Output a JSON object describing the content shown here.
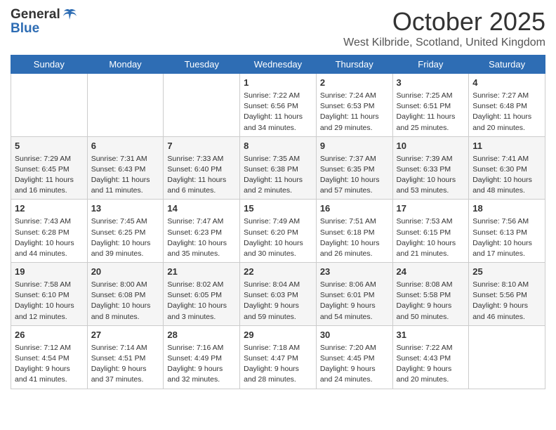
{
  "header": {
    "logo_line1": "General",
    "logo_line2": "Blue",
    "month": "October 2025",
    "location": "West Kilbride, Scotland, United Kingdom"
  },
  "days_of_week": [
    "Sunday",
    "Monday",
    "Tuesday",
    "Wednesday",
    "Thursday",
    "Friday",
    "Saturday"
  ],
  "weeks": [
    [
      {
        "day": "",
        "content": ""
      },
      {
        "day": "",
        "content": ""
      },
      {
        "day": "",
        "content": ""
      },
      {
        "day": "1",
        "content": "Sunrise: 7:22 AM\nSunset: 6:56 PM\nDaylight: 11 hours and 34 minutes."
      },
      {
        "day": "2",
        "content": "Sunrise: 7:24 AM\nSunset: 6:53 PM\nDaylight: 11 hours and 29 minutes."
      },
      {
        "day": "3",
        "content": "Sunrise: 7:25 AM\nSunset: 6:51 PM\nDaylight: 11 hours and 25 minutes."
      },
      {
        "day": "4",
        "content": "Sunrise: 7:27 AM\nSunset: 6:48 PM\nDaylight: 11 hours and 20 minutes."
      }
    ],
    [
      {
        "day": "5",
        "content": "Sunrise: 7:29 AM\nSunset: 6:45 PM\nDaylight: 11 hours and 16 minutes."
      },
      {
        "day": "6",
        "content": "Sunrise: 7:31 AM\nSunset: 6:43 PM\nDaylight: 11 hours and 11 minutes."
      },
      {
        "day": "7",
        "content": "Sunrise: 7:33 AM\nSunset: 6:40 PM\nDaylight: 11 hours and 6 minutes."
      },
      {
        "day": "8",
        "content": "Sunrise: 7:35 AM\nSunset: 6:38 PM\nDaylight: 11 hours and 2 minutes."
      },
      {
        "day": "9",
        "content": "Sunrise: 7:37 AM\nSunset: 6:35 PM\nDaylight: 10 hours and 57 minutes."
      },
      {
        "day": "10",
        "content": "Sunrise: 7:39 AM\nSunset: 6:33 PM\nDaylight: 10 hours and 53 minutes."
      },
      {
        "day": "11",
        "content": "Sunrise: 7:41 AM\nSunset: 6:30 PM\nDaylight: 10 hours and 48 minutes."
      }
    ],
    [
      {
        "day": "12",
        "content": "Sunrise: 7:43 AM\nSunset: 6:28 PM\nDaylight: 10 hours and 44 minutes."
      },
      {
        "day": "13",
        "content": "Sunrise: 7:45 AM\nSunset: 6:25 PM\nDaylight: 10 hours and 39 minutes."
      },
      {
        "day": "14",
        "content": "Sunrise: 7:47 AM\nSunset: 6:23 PM\nDaylight: 10 hours and 35 minutes."
      },
      {
        "day": "15",
        "content": "Sunrise: 7:49 AM\nSunset: 6:20 PM\nDaylight: 10 hours and 30 minutes."
      },
      {
        "day": "16",
        "content": "Sunrise: 7:51 AM\nSunset: 6:18 PM\nDaylight: 10 hours and 26 minutes."
      },
      {
        "day": "17",
        "content": "Sunrise: 7:53 AM\nSunset: 6:15 PM\nDaylight: 10 hours and 21 minutes."
      },
      {
        "day": "18",
        "content": "Sunrise: 7:56 AM\nSunset: 6:13 PM\nDaylight: 10 hours and 17 minutes."
      }
    ],
    [
      {
        "day": "19",
        "content": "Sunrise: 7:58 AM\nSunset: 6:10 PM\nDaylight: 10 hours and 12 minutes."
      },
      {
        "day": "20",
        "content": "Sunrise: 8:00 AM\nSunset: 6:08 PM\nDaylight: 10 hours and 8 minutes."
      },
      {
        "day": "21",
        "content": "Sunrise: 8:02 AM\nSunset: 6:05 PM\nDaylight: 10 hours and 3 minutes."
      },
      {
        "day": "22",
        "content": "Sunrise: 8:04 AM\nSunset: 6:03 PM\nDaylight: 9 hours and 59 minutes."
      },
      {
        "day": "23",
        "content": "Sunrise: 8:06 AM\nSunset: 6:01 PM\nDaylight: 9 hours and 54 minutes."
      },
      {
        "day": "24",
        "content": "Sunrise: 8:08 AM\nSunset: 5:58 PM\nDaylight: 9 hours and 50 minutes."
      },
      {
        "day": "25",
        "content": "Sunrise: 8:10 AM\nSunset: 5:56 PM\nDaylight: 9 hours and 46 minutes."
      }
    ],
    [
      {
        "day": "26",
        "content": "Sunrise: 7:12 AM\nSunset: 4:54 PM\nDaylight: 9 hours and 41 minutes."
      },
      {
        "day": "27",
        "content": "Sunrise: 7:14 AM\nSunset: 4:51 PM\nDaylight: 9 hours and 37 minutes."
      },
      {
        "day": "28",
        "content": "Sunrise: 7:16 AM\nSunset: 4:49 PM\nDaylight: 9 hours and 32 minutes."
      },
      {
        "day": "29",
        "content": "Sunrise: 7:18 AM\nSunset: 4:47 PM\nDaylight: 9 hours and 28 minutes."
      },
      {
        "day": "30",
        "content": "Sunrise: 7:20 AM\nSunset: 4:45 PM\nDaylight: 9 hours and 24 minutes."
      },
      {
        "day": "31",
        "content": "Sunrise: 7:22 AM\nSunset: 4:43 PM\nDaylight: 9 hours and 20 minutes."
      },
      {
        "day": "",
        "content": ""
      }
    ]
  ]
}
